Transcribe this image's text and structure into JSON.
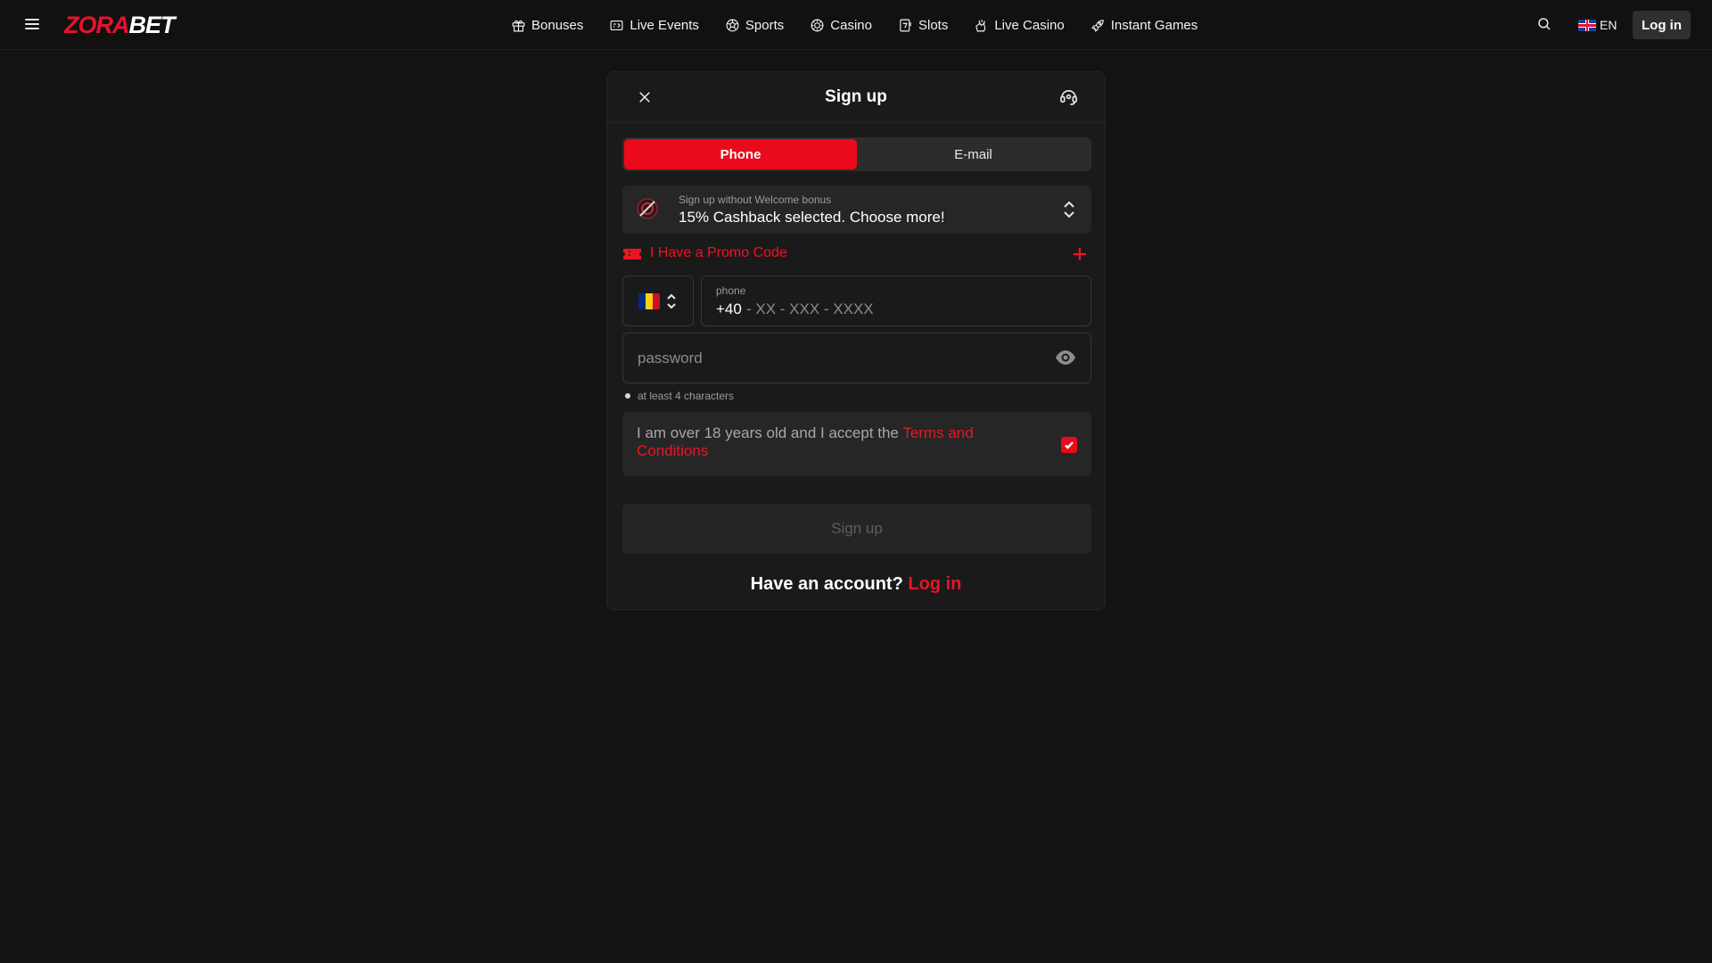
{
  "header": {
    "logo": {
      "part1": "ZORA",
      "part2": "BET"
    },
    "nav": [
      {
        "label": "Bonuses",
        "icon": "gift-icon"
      },
      {
        "label": "Live Events",
        "icon": "live-events-icon"
      },
      {
        "label": "Sports",
        "icon": "soccer-ball-icon"
      },
      {
        "label": "Casino",
        "icon": "casino-chip-icon"
      },
      {
        "label": "Slots",
        "icon": "slots-icon"
      },
      {
        "label": "Live Casino",
        "icon": "live-casino-icon"
      },
      {
        "label": "Instant Games",
        "icon": "rocket-icon"
      }
    ],
    "language": "EN",
    "login_label": "Log in"
  },
  "modal": {
    "title": "Sign up",
    "tabs": [
      {
        "label": "Phone",
        "active": true
      },
      {
        "label": "E-mail",
        "active": false
      }
    ],
    "bonus": {
      "small_label": "Sign up without Welcome bonus",
      "selected": "15% Cashback selected. Choose more!"
    },
    "promo_label": "I Have a Promo Code",
    "phone": {
      "label": "phone",
      "prefix": "+40",
      "placeholder": "- XX - XXX - XXXX",
      "country": "Romania"
    },
    "password": {
      "placeholder": "password"
    },
    "password_hint": "at least 4 characters",
    "terms": {
      "text": "I am over 18 years old and I accept the ",
      "link": "Terms and Conditions",
      "checked": true
    },
    "submit_label": "Sign up",
    "footer": {
      "question": "Have an account?",
      "link": "Log in"
    }
  },
  "colors": {
    "accent": "#ea0a1b",
    "background": "#131313",
    "panel": "#1a1a1a"
  }
}
